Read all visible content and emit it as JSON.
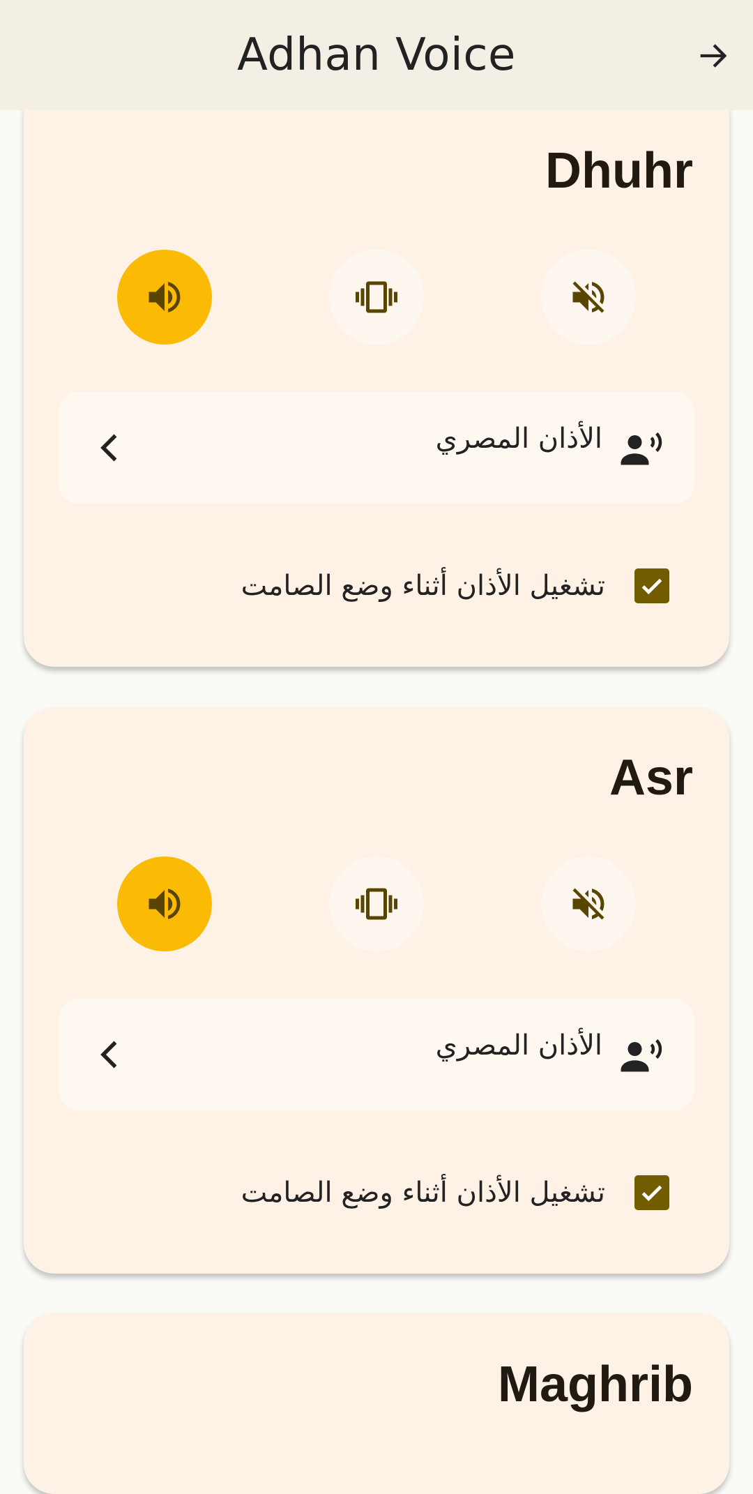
{
  "appbar": {
    "title": "Adhan Voice"
  },
  "colors": {
    "accent": "#fbbb04",
    "checkbox": "#735c00",
    "card": "#fdf2e5",
    "icon": "#5a4500"
  },
  "prayers": [
    {
      "name": "Dhuhr",
      "mode": "sound",
      "voice": "الأذان المصري",
      "silent_label": "تشغيل الأذان أثناء وضع الصامت",
      "silent_checked": true
    },
    {
      "name": "Asr",
      "mode": "sound",
      "voice": "الأذان المصري",
      "silent_label": "تشغيل الأذان أثناء وضع الصامت",
      "silent_checked": true
    },
    {
      "name": "Maghrib"
    }
  ],
  "icons": [
    "arrow-forward-icon",
    "volume-up-icon",
    "vibrate-icon",
    "volume-off-icon",
    "chevron-left-icon",
    "voice-person-icon",
    "checkmark-icon"
  ]
}
